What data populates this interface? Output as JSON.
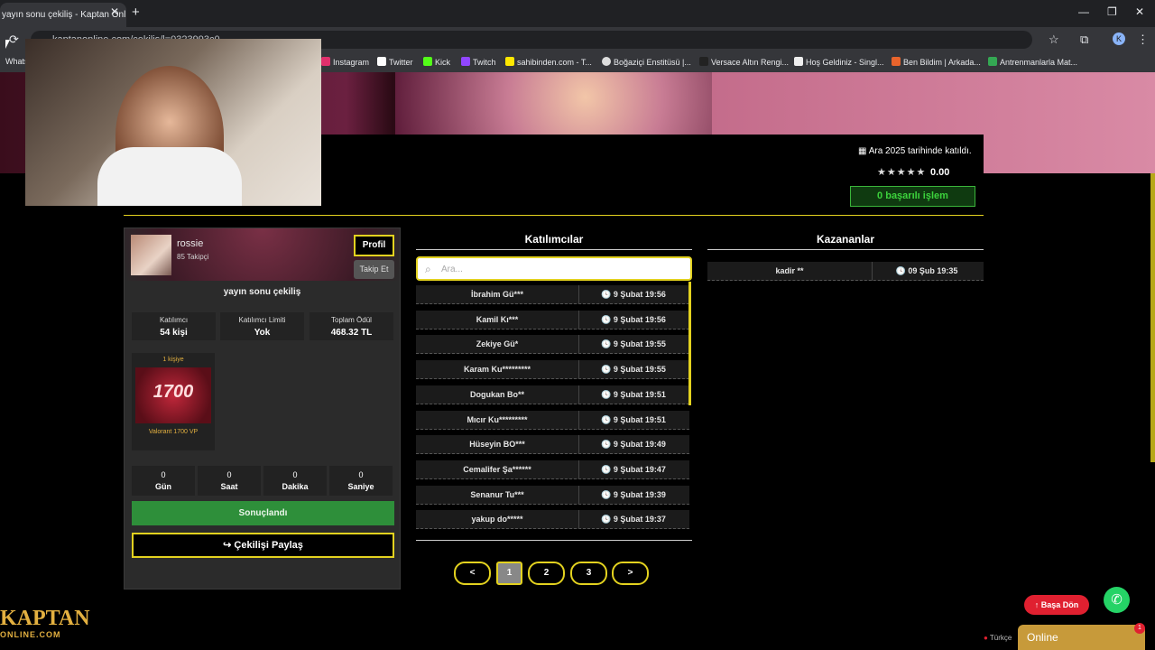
{
  "browser": {
    "tab_title": "yayın sonu çekiliş - Kaptan Onl...",
    "tab_close": "✕",
    "new_tab": "+",
    "url": "kaptanonline.com/cekilis/l=0323993c0",
    "window_controls": [
      "—",
      "❐",
      "✕"
    ],
    "avatar_letter": "K",
    "bookmarks": [
      {
        "label": "Whats",
        "color": "#25d366"
      },
      {
        "label": "Instagram",
        "color": "#e1306c"
      },
      {
        "label": "Twitter",
        "color": "#ffffff"
      },
      {
        "label": "Kick",
        "color": "#53fc18"
      },
      {
        "label": "Twitch",
        "color": "#9146ff"
      },
      {
        "label": "sahibinden.com - T...",
        "color": "#ffe800"
      },
      {
        "label": "Boğaziçi Enstitüsü |...",
        "color": "#dddddd"
      },
      {
        "label": "Versace Altın Rengi...",
        "color": "#222222"
      },
      {
        "label": "Hoş Geldiniz - Singl...",
        "color": "#eeeeee"
      },
      {
        "label": "Ben Bildim | Arkada...",
        "color": "#e8642c"
      },
      {
        "label": "Antrenmanlarla Mat...",
        "color": "#34a853"
      }
    ]
  },
  "profile": {
    "joined": "Ara 2025 tarihinde katıldı.",
    "stars": "★★★★★",
    "rating": "0.00",
    "success": "0 başarılı işlem"
  },
  "giveaway": {
    "username": "rossie",
    "followers": "85 Takipçi",
    "profile_button": "Profil",
    "follow_button": "Takip Et",
    "title": "yayın sonu çekiliş",
    "stats": [
      {
        "label": "Katılımcı",
        "value": "54 kişi"
      },
      {
        "label": "Katılımcı Limiti",
        "value": "Yok"
      },
      {
        "label": "Toplam Ödül",
        "value": "468.32 TL"
      }
    ],
    "prize": {
      "count": "1 kişiye",
      "image_text": "1700",
      "name": "Valorant 1700 VP"
    },
    "countdown": [
      {
        "n": "0",
        "unit": "Gün"
      },
      {
        "n": "0",
        "unit": "Saat"
      },
      {
        "n": "0",
        "unit": "Dakika"
      },
      {
        "n": "0",
        "unit": "Saniye"
      }
    ],
    "result_button": "Sonuçlandı",
    "share_button": "↪ Çekilişi Paylaş"
  },
  "participants": {
    "title": "Katılımcılar",
    "search_placeholder": "Ara...",
    "rows": [
      {
        "name": "İbrahim Gü***",
        "date": "🕓 9 Şubat 19:56"
      },
      {
        "name": "Kamil Kı***",
        "date": "🕓 9 Şubat 19:56"
      },
      {
        "name": "Zekiye Gü*",
        "date": "🕓 9 Şubat 19:55"
      },
      {
        "name": "Karam Ku*********",
        "date": "🕓 9 Şubat 19:55"
      },
      {
        "name": "Dogukan Bo**",
        "date": "🕓 9 Şubat 19:51"
      },
      {
        "name": "Mıcır Ku*********",
        "date": "🕓 9 Şubat 19:51"
      },
      {
        "name": "Hüseyin BO***",
        "date": "🕓 9 Şubat 19:49"
      },
      {
        "name": "Cemalifer Şa******",
        "date": "🕓 9 Şubat 19:47"
      },
      {
        "name": "Senanur Tu***",
        "date": "🕓 9 Şubat 19:39"
      },
      {
        "name": "yakup do*****",
        "date": "🕓 9 Şubat 19:37"
      }
    ],
    "pagination": [
      "<",
      "1",
      "2",
      "3",
      ">"
    ]
  },
  "winners": {
    "title": "Kazananlar",
    "rows": [
      {
        "name": "kadir **",
        "date": "🕓 09 Şub 19:35"
      }
    ]
  },
  "footer": {
    "logo_top": "KAPTAN",
    "logo_bottom": "ONLINE.COM",
    "back_to_top": "↑ Başa Dön",
    "whatsapp": "✆",
    "language": "Türkçe",
    "online": "Online",
    "online_badge": "1"
  },
  "colors": {
    "accent": "#e3d21f",
    "success": "#3cd23c",
    "danger": "#e02030"
  }
}
